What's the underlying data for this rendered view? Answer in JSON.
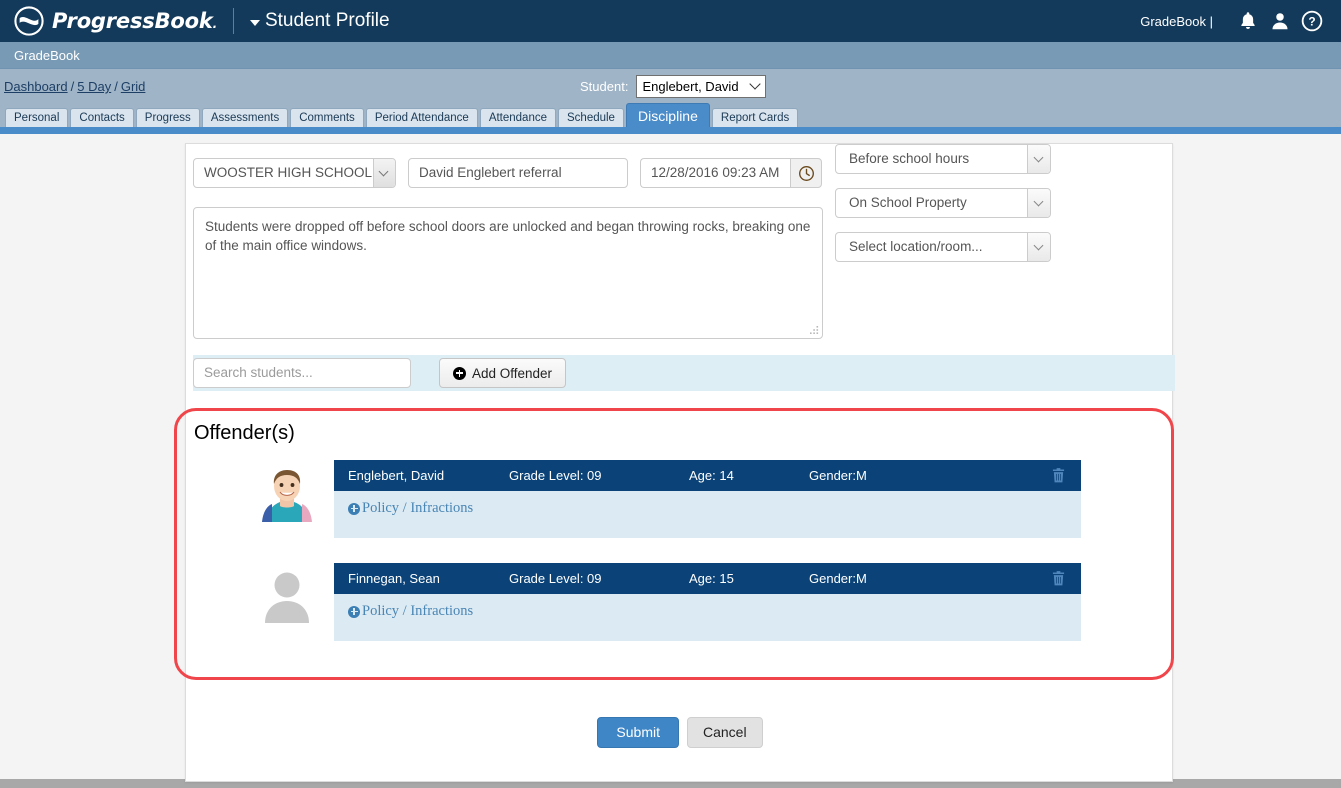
{
  "header": {
    "brand_name_bold": "Progress",
    "brand_name_light": "Book",
    "brand_trademark": ".",
    "page_title": "Student Profile",
    "context_label": "GradeBook |",
    "icons": [
      "bell-icon",
      "user-icon",
      "help-icon"
    ]
  },
  "subheader": {
    "label": "GradeBook"
  },
  "breadcrumb": {
    "items": [
      {
        "label": "Dashboard"
      },
      {
        "label": "5 Day"
      },
      {
        "label": "Grid"
      }
    ],
    "separator": "/"
  },
  "student_selector": {
    "label": "Student:",
    "value": "Englebert, David"
  },
  "tabs": [
    {
      "label": "Personal",
      "active": false
    },
    {
      "label": "Contacts",
      "active": false
    },
    {
      "label": "Progress",
      "active": false
    },
    {
      "label": "Assessments",
      "active": false
    },
    {
      "label": "Comments",
      "active": false
    },
    {
      "label": "Period Attendance",
      "active": false
    },
    {
      "label": "Attendance",
      "active": false
    },
    {
      "label": "Schedule",
      "active": false
    },
    {
      "label": "Discipline",
      "active": true
    },
    {
      "label": "Report Cards",
      "active": false
    }
  ],
  "form": {
    "school": "WOOSTER HIGH SCHOOL",
    "incident_title": "David Englebert referral",
    "incident_datetime": "12/28/2016 09:23 AM",
    "clock_icon": "clock-icon",
    "description": "Students were dropped off before school doors are unlocked and began throwing rocks, breaking one of the main office windows.",
    "time_frame": "Before school hours",
    "location_type": "On School Property",
    "location_room": "Select location/room..."
  },
  "search_row": {
    "placeholder": "Search students...",
    "search_value": "",
    "add_offender_label": "Add Offender"
  },
  "offenders_section": {
    "heading": "Offender(s)",
    "policy_link_label": "Policy / Infractions",
    "delete_icon": "trash-icon",
    "students": [
      {
        "name": "Englebert, David",
        "grade_level": "Grade Level: 09",
        "age": "Age: 14",
        "gender": "Gender:M",
        "avatar": "student-photo"
      },
      {
        "name": "Finnegan, Sean",
        "grade_level": "Grade Level: 09",
        "age": "Age: 15",
        "gender": "Gender:M",
        "avatar": "placeholder-silhouette"
      }
    ]
  },
  "footer": {
    "submit_label": "Submit",
    "cancel_label": "Cancel"
  },
  "colors": {
    "header_navy": "#133a5b",
    "accent_blue": "#4a8bc9",
    "row_navy": "#0b4378",
    "policy_band": "#dceaf3",
    "highlight_red": "#f0464b"
  }
}
